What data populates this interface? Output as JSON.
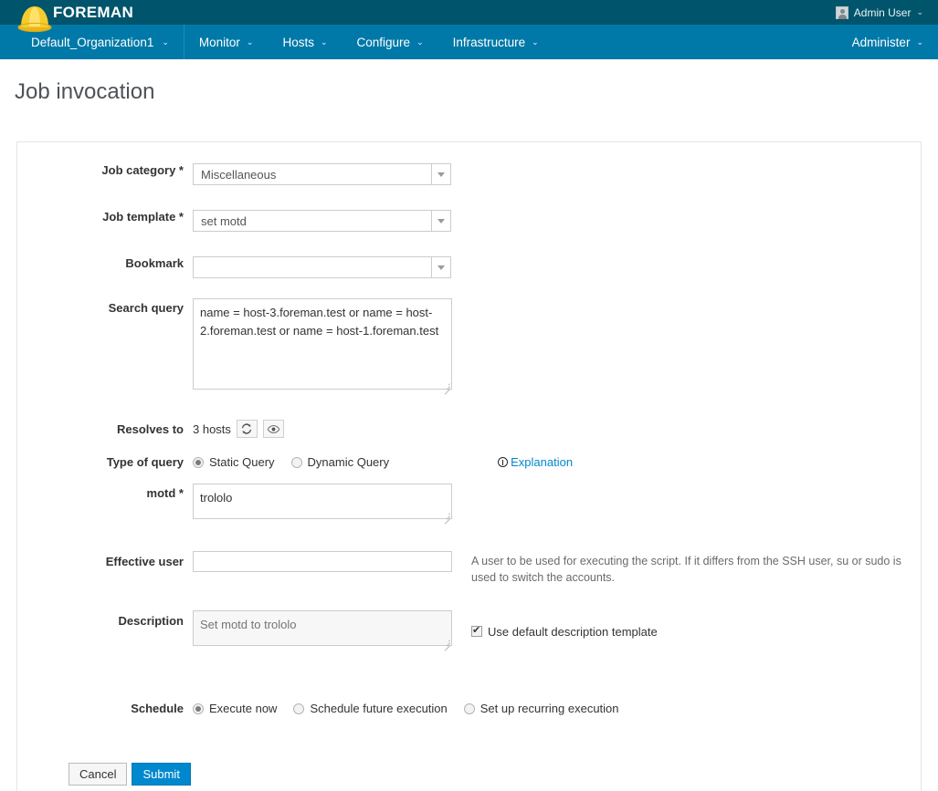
{
  "topbar": {
    "brand": "FOREMAN",
    "brand_icon": "hardhat-icon",
    "user_label": "Admin User",
    "user_icon": "avatar-icon",
    "caret": "⌄",
    "bg_color": "#00546b"
  },
  "nav": {
    "organization": "Default_Organization1",
    "items": [
      {
        "label": "Monitor"
      },
      {
        "label": "Hosts"
      },
      {
        "label": "Configure"
      },
      {
        "label": "Infrastructure"
      }
    ],
    "right_item": "Administer",
    "bg_color": "#0079a8"
  },
  "page": {
    "title": "Job invocation"
  },
  "form": {
    "job_category": {
      "label": "Job category *",
      "value": "Miscellaneous"
    },
    "job_template": {
      "label": "Job template *",
      "value": "set motd"
    },
    "bookmark": {
      "label": "Bookmark",
      "value": ""
    },
    "search_query": {
      "label": "Search query",
      "value": "name = host-3.foreman.test or name = host-2.foreman.test or name = host-1.foreman.test"
    },
    "resolves_to": {
      "label": "Resolves to",
      "value": "3 hosts",
      "refresh_icon": "refresh-icon",
      "preview_icon": "eye-icon"
    },
    "type_of_query": {
      "label": "Type of query",
      "options": [
        {
          "label": "Static Query",
          "selected": true
        },
        {
          "label": "Dynamic Query",
          "selected": false
        }
      ],
      "explanation_link": "Explanation",
      "explanation_icon": "info-icon"
    },
    "motd": {
      "label": "motd *",
      "value": "trololo"
    },
    "effective_user": {
      "label": "Effective user",
      "value": "",
      "help": "A user to be used for executing the script. If it differs from the SSH user, su or sudo is used to switch the accounts."
    },
    "description": {
      "label": "Description",
      "placeholder": "Set motd to trololo",
      "value": "",
      "checkbox_label": "Use default description template",
      "checkbox_checked": true
    },
    "schedule": {
      "label": "Schedule",
      "options": [
        {
          "label": "Execute now",
          "selected": true
        },
        {
          "label": "Schedule future execution",
          "selected": false
        },
        {
          "label": "Set up recurring execution",
          "selected": false
        }
      ]
    },
    "actions": {
      "cancel_label": "Cancel",
      "submit_label": "Submit",
      "submit_color": "#0088ce"
    }
  }
}
